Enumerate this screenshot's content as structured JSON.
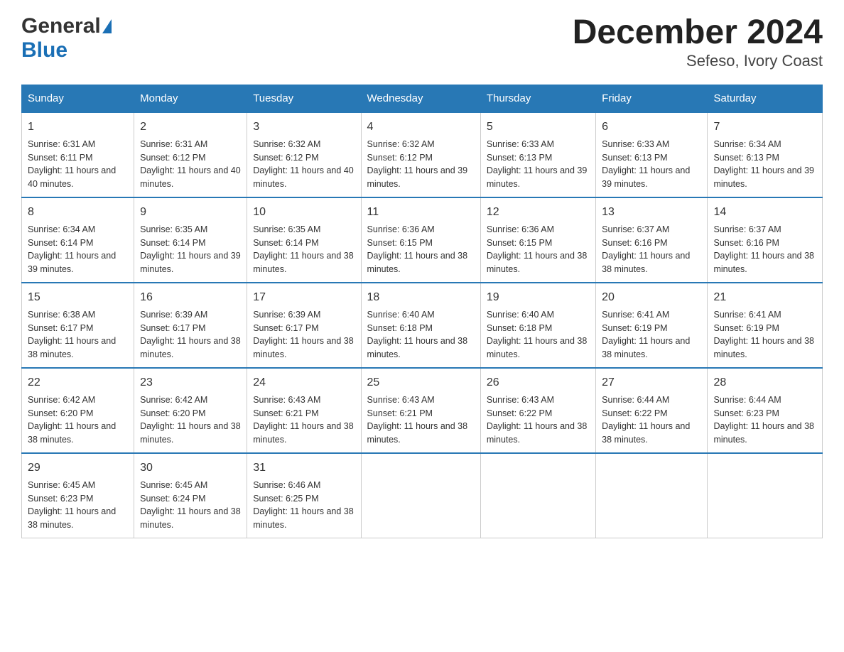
{
  "logo": {
    "general": "General",
    "blue": "Blue"
  },
  "title": "December 2024",
  "subtitle": "Sefeso, Ivory Coast",
  "days_of_week": [
    "Sunday",
    "Monday",
    "Tuesday",
    "Wednesday",
    "Thursday",
    "Friday",
    "Saturday"
  ],
  "weeks": [
    [
      {
        "day": "1",
        "sunrise": "Sunrise: 6:31 AM",
        "sunset": "Sunset: 6:11 PM",
        "daylight": "Daylight: 11 hours and 40 minutes."
      },
      {
        "day": "2",
        "sunrise": "Sunrise: 6:31 AM",
        "sunset": "Sunset: 6:12 PM",
        "daylight": "Daylight: 11 hours and 40 minutes."
      },
      {
        "day": "3",
        "sunrise": "Sunrise: 6:32 AM",
        "sunset": "Sunset: 6:12 PM",
        "daylight": "Daylight: 11 hours and 40 minutes."
      },
      {
        "day": "4",
        "sunrise": "Sunrise: 6:32 AM",
        "sunset": "Sunset: 6:12 PM",
        "daylight": "Daylight: 11 hours and 39 minutes."
      },
      {
        "day": "5",
        "sunrise": "Sunrise: 6:33 AM",
        "sunset": "Sunset: 6:13 PM",
        "daylight": "Daylight: 11 hours and 39 minutes."
      },
      {
        "day": "6",
        "sunrise": "Sunrise: 6:33 AM",
        "sunset": "Sunset: 6:13 PM",
        "daylight": "Daylight: 11 hours and 39 minutes."
      },
      {
        "day": "7",
        "sunrise": "Sunrise: 6:34 AM",
        "sunset": "Sunset: 6:13 PM",
        "daylight": "Daylight: 11 hours and 39 minutes."
      }
    ],
    [
      {
        "day": "8",
        "sunrise": "Sunrise: 6:34 AM",
        "sunset": "Sunset: 6:14 PM",
        "daylight": "Daylight: 11 hours and 39 minutes."
      },
      {
        "day": "9",
        "sunrise": "Sunrise: 6:35 AM",
        "sunset": "Sunset: 6:14 PM",
        "daylight": "Daylight: 11 hours and 39 minutes."
      },
      {
        "day": "10",
        "sunrise": "Sunrise: 6:35 AM",
        "sunset": "Sunset: 6:14 PM",
        "daylight": "Daylight: 11 hours and 38 minutes."
      },
      {
        "day": "11",
        "sunrise": "Sunrise: 6:36 AM",
        "sunset": "Sunset: 6:15 PM",
        "daylight": "Daylight: 11 hours and 38 minutes."
      },
      {
        "day": "12",
        "sunrise": "Sunrise: 6:36 AM",
        "sunset": "Sunset: 6:15 PM",
        "daylight": "Daylight: 11 hours and 38 minutes."
      },
      {
        "day": "13",
        "sunrise": "Sunrise: 6:37 AM",
        "sunset": "Sunset: 6:16 PM",
        "daylight": "Daylight: 11 hours and 38 minutes."
      },
      {
        "day": "14",
        "sunrise": "Sunrise: 6:37 AM",
        "sunset": "Sunset: 6:16 PM",
        "daylight": "Daylight: 11 hours and 38 minutes."
      }
    ],
    [
      {
        "day": "15",
        "sunrise": "Sunrise: 6:38 AM",
        "sunset": "Sunset: 6:17 PM",
        "daylight": "Daylight: 11 hours and 38 minutes."
      },
      {
        "day": "16",
        "sunrise": "Sunrise: 6:39 AM",
        "sunset": "Sunset: 6:17 PM",
        "daylight": "Daylight: 11 hours and 38 minutes."
      },
      {
        "day": "17",
        "sunrise": "Sunrise: 6:39 AM",
        "sunset": "Sunset: 6:17 PM",
        "daylight": "Daylight: 11 hours and 38 minutes."
      },
      {
        "day": "18",
        "sunrise": "Sunrise: 6:40 AM",
        "sunset": "Sunset: 6:18 PM",
        "daylight": "Daylight: 11 hours and 38 minutes."
      },
      {
        "day": "19",
        "sunrise": "Sunrise: 6:40 AM",
        "sunset": "Sunset: 6:18 PM",
        "daylight": "Daylight: 11 hours and 38 minutes."
      },
      {
        "day": "20",
        "sunrise": "Sunrise: 6:41 AM",
        "sunset": "Sunset: 6:19 PM",
        "daylight": "Daylight: 11 hours and 38 minutes."
      },
      {
        "day": "21",
        "sunrise": "Sunrise: 6:41 AM",
        "sunset": "Sunset: 6:19 PM",
        "daylight": "Daylight: 11 hours and 38 minutes."
      }
    ],
    [
      {
        "day": "22",
        "sunrise": "Sunrise: 6:42 AM",
        "sunset": "Sunset: 6:20 PM",
        "daylight": "Daylight: 11 hours and 38 minutes."
      },
      {
        "day": "23",
        "sunrise": "Sunrise: 6:42 AM",
        "sunset": "Sunset: 6:20 PM",
        "daylight": "Daylight: 11 hours and 38 minutes."
      },
      {
        "day": "24",
        "sunrise": "Sunrise: 6:43 AM",
        "sunset": "Sunset: 6:21 PM",
        "daylight": "Daylight: 11 hours and 38 minutes."
      },
      {
        "day": "25",
        "sunrise": "Sunrise: 6:43 AM",
        "sunset": "Sunset: 6:21 PM",
        "daylight": "Daylight: 11 hours and 38 minutes."
      },
      {
        "day": "26",
        "sunrise": "Sunrise: 6:43 AM",
        "sunset": "Sunset: 6:22 PM",
        "daylight": "Daylight: 11 hours and 38 minutes."
      },
      {
        "day": "27",
        "sunrise": "Sunrise: 6:44 AM",
        "sunset": "Sunset: 6:22 PM",
        "daylight": "Daylight: 11 hours and 38 minutes."
      },
      {
        "day": "28",
        "sunrise": "Sunrise: 6:44 AM",
        "sunset": "Sunset: 6:23 PM",
        "daylight": "Daylight: 11 hours and 38 minutes."
      }
    ],
    [
      {
        "day": "29",
        "sunrise": "Sunrise: 6:45 AM",
        "sunset": "Sunset: 6:23 PM",
        "daylight": "Daylight: 11 hours and 38 minutes."
      },
      {
        "day": "30",
        "sunrise": "Sunrise: 6:45 AM",
        "sunset": "Sunset: 6:24 PM",
        "daylight": "Daylight: 11 hours and 38 minutes."
      },
      {
        "day": "31",
        "sunrise": "Sunrise: 6:46 AM",
        "sunset": "Sunset: 6:25 PM",
        "daylight": "Daylight: 11 hours and 38 minutes."
      },
      null,
      null,
      null,
      null
    ]
  ]
}
